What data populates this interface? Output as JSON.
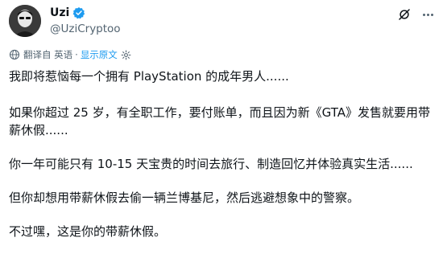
{
  "author": {
    "display_name": "Uzi",
    "handle": "@UziCryptoo"
  },
  "icons": {
    "avatar": "avatar-image",
    "verified": "verified-badge-icon",
    "grok": "grok-icon",
    "more": "more-options-icon",
    "translate": "translate-icon",
    "settings": "gear-icon"
  },
  "translation": {
    "translated_from": "翻译自 英语",
    "separator": "·",
    "show_original": "显示原文"
  },
  "colors": {
    "accent": "#1d9bf0",
    "secondary_text": "#536471",
    "primary_text": "#0f1419"
  },
  "post": {
    "paragraphs": [
      "我即将惹恼每一个拥有 PlayStation 的成年男人......",
      "如果你超过 25 岁，有全职工作，要付账单，而且因为新《GTA》发售就要用带薪休假......",
      "你一年可能只有 10-15 天宝贵的时间去旅行、制造回忆并体验真实生活......",
      "但你却想用带薪休假去偷一辆兰博基尼，然后逃避想象中的警察。",
      "不过嘿，这是你的带薪休假。"
    ]
  }
}
